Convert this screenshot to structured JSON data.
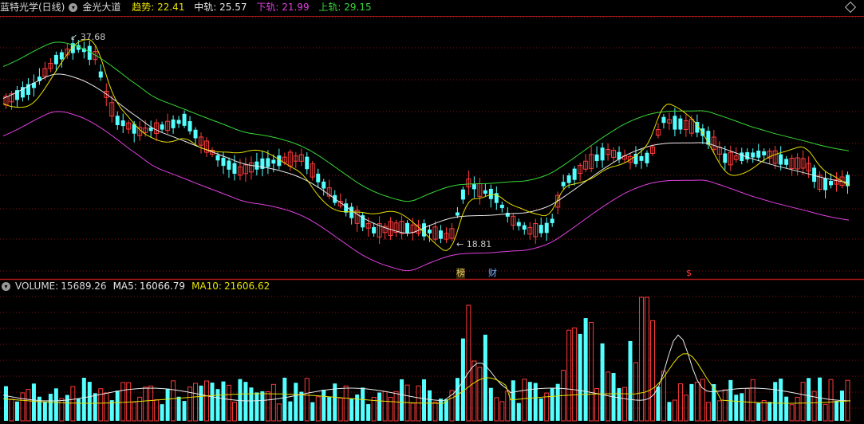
{
  "main": {
    "stock_title": "蓝特光学(日线)",
    "indicator_name": "金光大道",
    "trend_label": "趋势:",
    "trend_value": "22.41",
    "mid_label": "中轨:",
    "mid_value": "25.57",
    "low_label": "下轨:",
    "low_value": "21.99",
    "up_label": "上轨:",
    "up_value": "29.15",
    "high_marker": "37.68",
    "low_marker": "18.81",
    "event_marks": [
      "榜",
      "财",
      "$"
    ]
  },
  "volume": {
    "volume_label": "VOLUME:",
    "volume_value": "15689.26",
    "ma5_label": "MA5:",
    "ma5_value": "16066.79",
    "ma10_label": "MA10:",
    "ma10_value": "21606.62"
  },
  "colors": {
    "up_candle": "#ff3b3b",
    "down_candle": "#54ffff",
    "trend_line": "#e8e000",
    "mid_line": "#e8e8e8",
    "lower_band": "#e040e0",
    "upper_band": "#38d838",
    "grid": "#8a1010",
    "divider": "#b01818"
  }
}
